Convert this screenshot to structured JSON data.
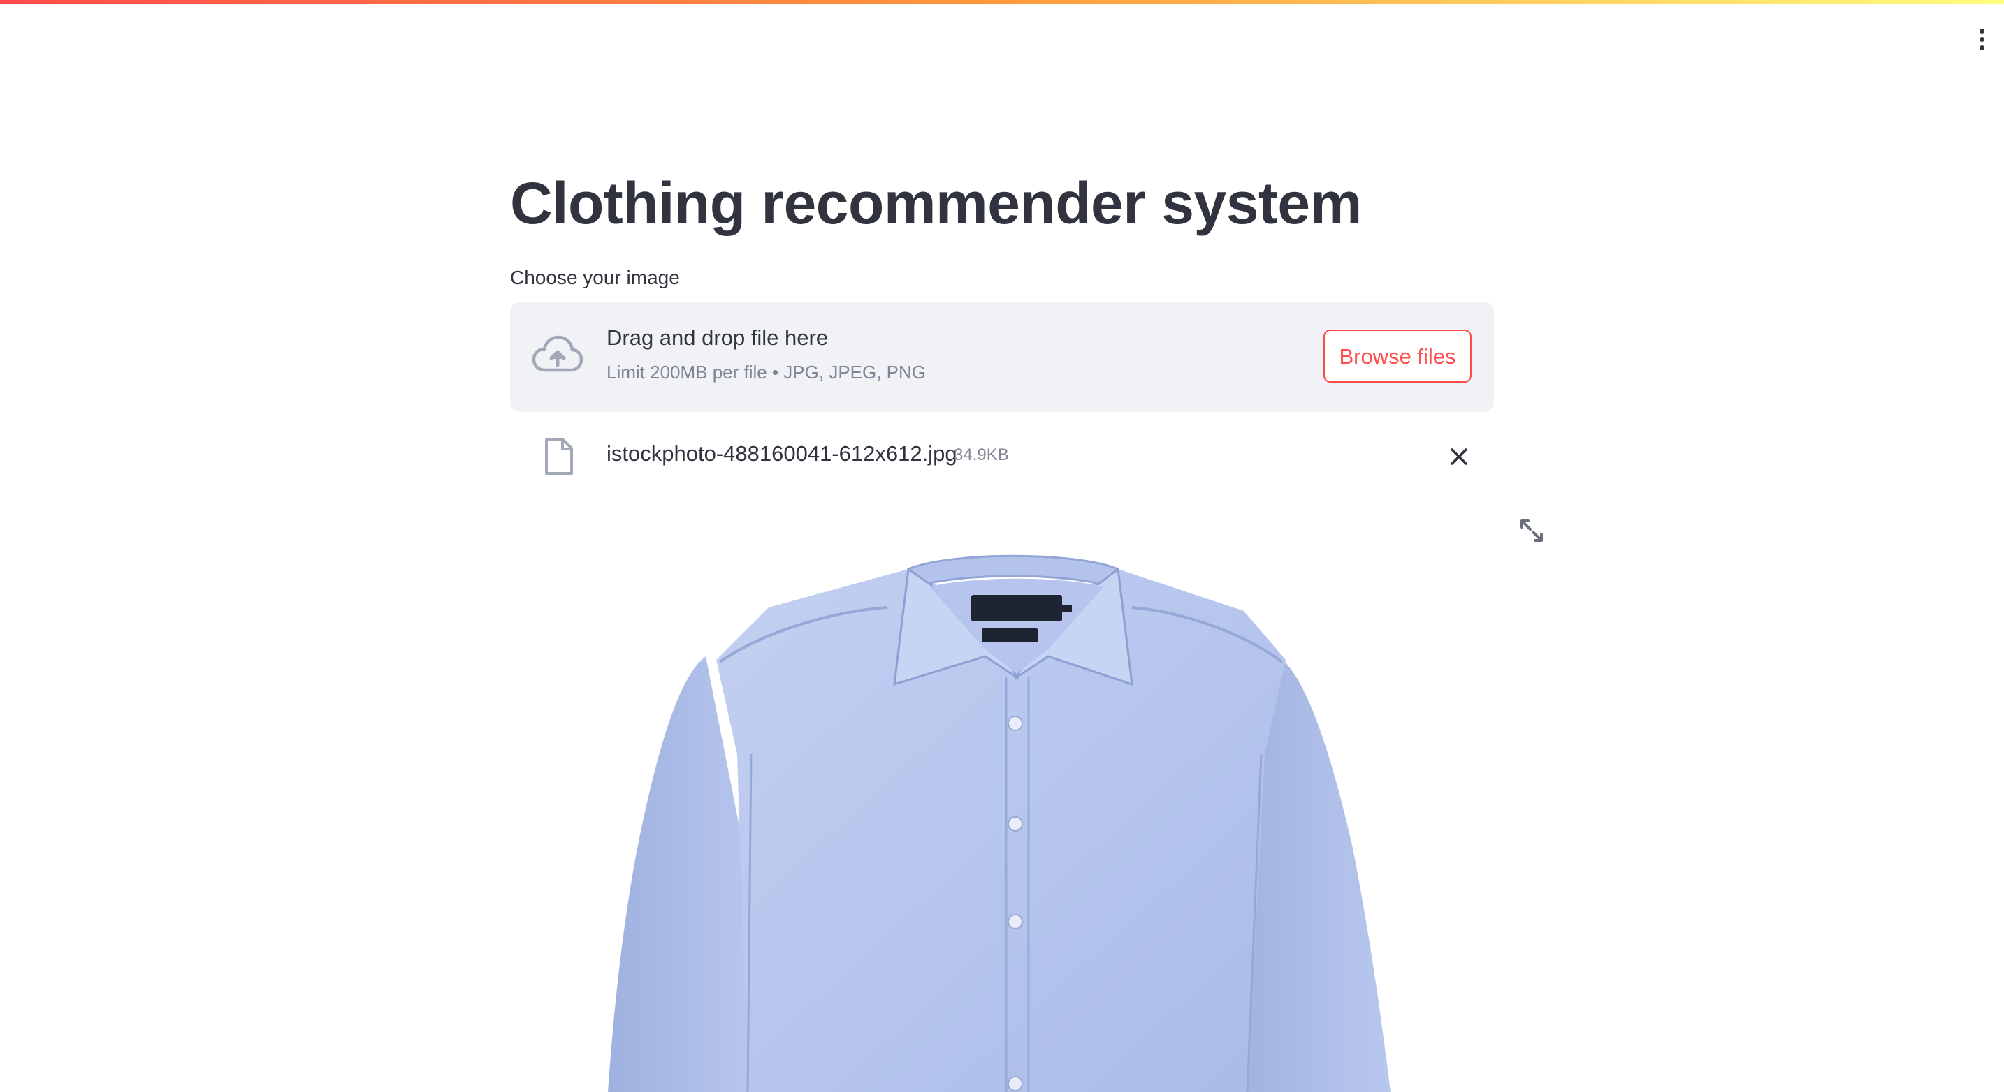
{
  "app": {
    "title": "Clothing recommender system",
    "menu_icon": "vertical-ellipsis-icon",
    "accent_color": "#ff4b4b"
  },
  "uploader": {
    "label": "Choose your image",
    "drop_text": "Drag and drop file here",
    "limit_text": "Limit 200MB per file • JPG, JPEG, PNG",
    "browse_label": "Browse files",
    "upload_icon": "cloud-upload-icon"
  },
  "uploaded_file": {
    "name": "istockphoto-488160041-612x612.jpg",
    "size": "34.9KB",
    "file_icon": "file-icon",
    "remove_icon": "close-icon"
  },
  "image": {
    "subject": "blue dress shirt",
    "fullscreen_icon": "fullscreen-icon"
  }
}
